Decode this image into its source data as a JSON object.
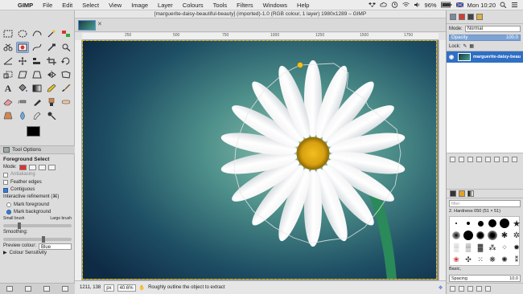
{
  "menubar": {
    "apple_icon": "apple-icon",
    "app_name": "GIMP",
    "items": [
      "File",
      "Edit",
      "Select",
      "View",
      "Image",
      "Layer",
      "Colours",
      "Tools",
      "Filters",
      "Windows",
      "Help"
    ],
    "battery": "96%",
    "clock": "Mon 10:20"
  },
  "image_window": {
    "title": "[marguerite-daisy-beautiful-beauty] (imported)-1.0 (RGB colour, 1 layer) 1980x1289 – GIMP",
    "ruler_ticks": [
      "250",
      "500",
      "750",
      "1000",
      "1250",
      "1500",
      "1750"
    ],
    "status": {
      "coords": "1211, 138",
      "unit": "px",
      "zoom": "40.6%",
      "message": "Roughly outline the object to extract"
    }
  },
  "tool_options": {
    "tab_label": "Tool Options",
    "title": "Foreground Select",
    "mode_label": "Mode:",
    "antialiasing": "Antialiasing",
    "feather_edges": "Feather edges",
    "contiguous": "Contiguous",
    "interactive_refinement": "Interactive refinement  (⌘)",
    "mark_foreground": "Mark foreground",
    "mark_background": "Mark background",
    "small_brush": "Small brush",
    "large_brush": "Large brush",
    "smoothing": "Smoothing:",
    "preview_colour_label": "Preview colour:",
    "preview_colour_value": "Blue",
    "colour_sensitivity": "Colour Sensitivity"
  },
  "dock": {
    "mode_label": "Mode:",
    "mode_value": "Normal",
    "opacity_label": "Opacity",
    "opacity_value": "100.0",
    "lock_label": "Lock:",
    "layer_name": "marguerite-daisy-beau",
    "brush_filter_placeholder": "filter",
    "brush_name": "2. Hardness 050 (51 × 51)",
    "brush_category": "Basic,",
    "spacing_label": "Spacing",
    "spacing_value": "10.0"
  }
}
